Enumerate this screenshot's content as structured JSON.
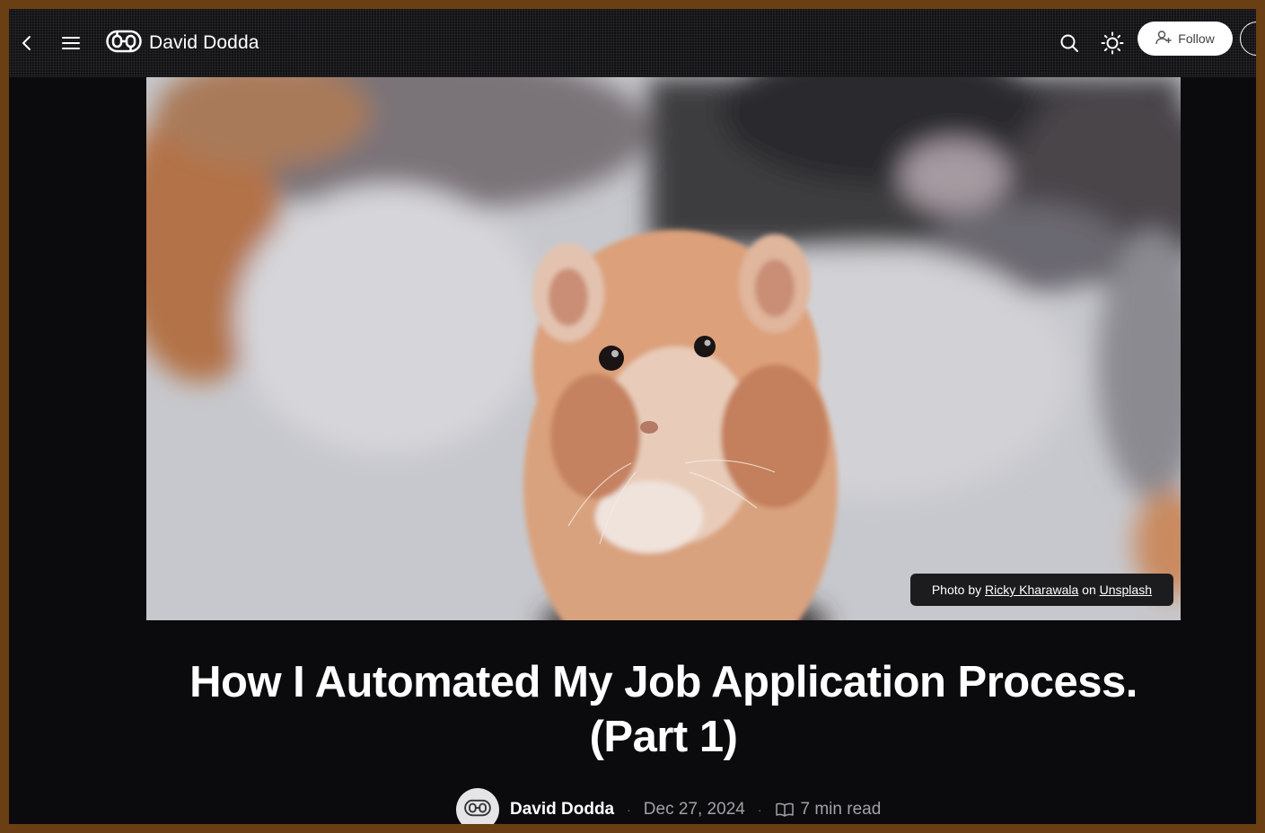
{
  "header": {
    "blog_name": "David Dodda",
    "follow_label": "Follow",
    "icons": [
      "chevron-left-icon",
      "menu-icon",
      "logo-icon",
      "search-icon",
      "sun-icon",
      "user-plus-icon",
      "newsletter-icon"
    ]
  },
  "cover": {
    "caption_prefix": "Photo by ",
    "photographer": "Ricky Kharawala",
    "caption_middle": " on ",
    "source": "Unsplash"
  },
  "article": {
    "title": "How I Automated My Job Application Process. (Part 1)",
    "author": "David Dodda",
    "date": "Dec 27, 2024",
    "read_time": "7 min read",
    "separator": "·"
  },
  "colors": {
    "page_bg": "#0b0b0d",
    "border": "#6b3f14",
    "text": "#ffffff",
    "muted": "#a1a1aa"
  }
}
